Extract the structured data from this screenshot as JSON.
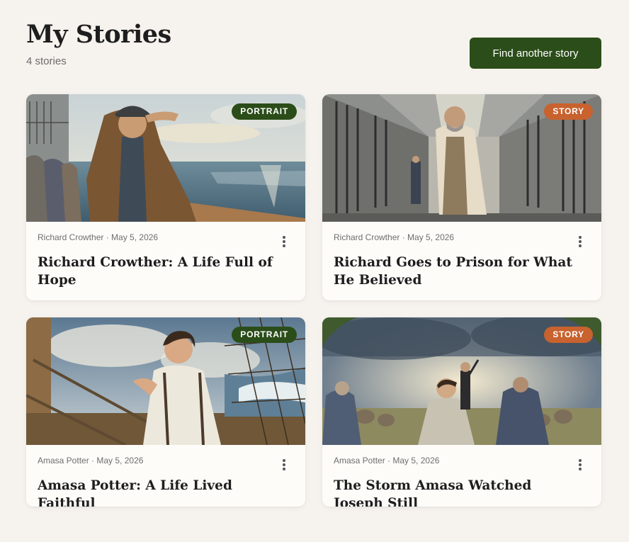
{
  "header": {
    "title": "My Stories",
    "count_label": "4 stories",
    "find_button_label": "Find another story"
  },
  "colors": {
    "background": "#f6f3ee",
    "primary": "#2b4d19",
    "portrait_badge": "#2b4d19",
    "story_badge": "#c8622e",
    "card": "#fdfcf9"
  },
  "cards": [
    {
      "badge": "PORTRAIT",
      "author": "Richard Crowther",
      "date": "May 5, 2026",
      "title": "Richard Crowther: A Life Full of Hope",
      "menu_icon": "more-vertical-icon"
    },
    {
      "badge": "STORY",
      "author": "Richard Crowther",
      "date": "May 5, 2026",
      "title": "Richard Goes to Prison for What He Believed",
      "menu_icon": "more-vertical-icon"
    },
    {
      "badge": "PORTRAIT",
      "author": "Amasa Potter",
      "date": "May 5, 2026",
      "title": "Amasa Potter: A Life Lived Faithful",
      "menu_icon": "more-vertical-icon"
    },
    {
      "badge": "STORY",
      "author": "Amasa Potter",
      "date": "May 5, 2026",
      "title": "The Storm Amasa Watched Joseph Still",
      "menu_icon": "more-vertical-icon"
    }
  ]
}
